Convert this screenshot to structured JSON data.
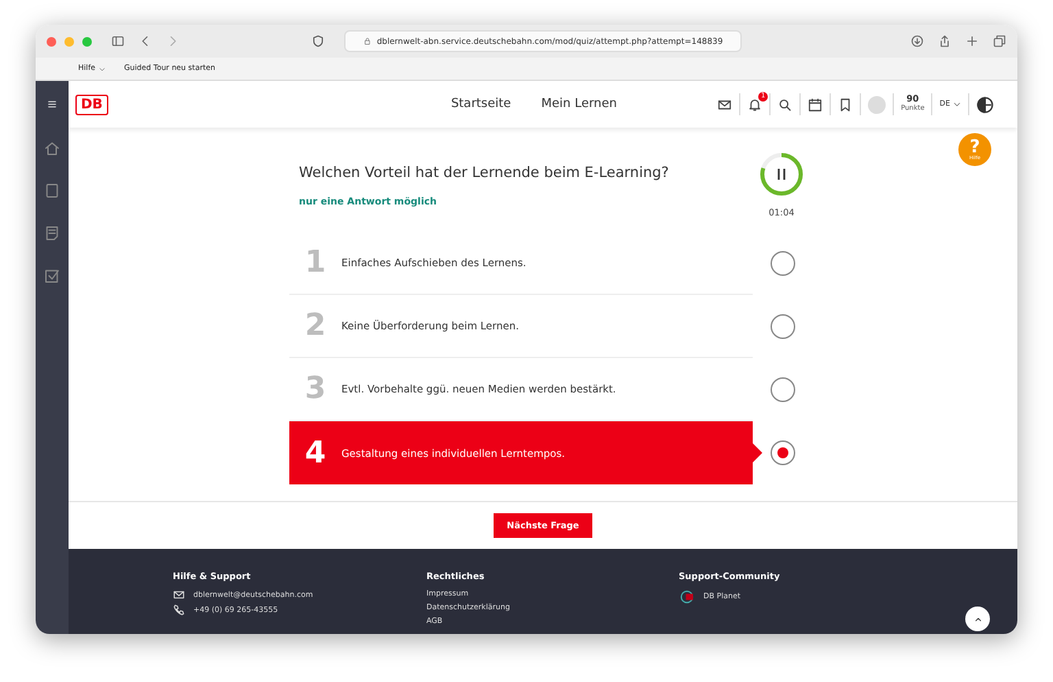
{
  "browser": {
    "url": "dblernwelt-abn.service.deutschebahn.com/mod/quiz/attempt.php?attempt=148839"
  },
  "bookmarks": [
    {
      "label": "Hilfe",
      "kind": "menu"
    },
    {
      "label": "Guided Tour neu starten",
      "kind": "link"
    }
  ],
  "header": {
    "logo": "DB",
    "nav": [
      {
        "label": "Startseite"
      },
      {
        "label": "Mein Lernen"
      }
    ],
    "notification_count": "1",
    "points": "90",
    "points_label": "Punkte",
    "language": "DE"
  },
  "help_button": {
    "icon": "?",
    "label": "Hilfe"
  },
  "question": {
    "text": "Welchen Vorteil hat der Lernende beim E-Learning?",
    "hint": "nur eine Antwort möglich",
    "timer": {
      "level": 0.8,
      "time": "01:04"
    }
  },
  "answers": [
    {
      "number": "1",
      "text": "Einfaches Aufschieben des Lernens.",
      "selected": false
    },
    {
      "number": "2",
      "text": "Keine Überforderung beim Lernen.",
      "selected": false
    },
    {
      "number": "3",
      "text": "Evtl. Vorbehalte ggü. neuen Medien werden bestärkt.",
      "selected": false
    },
    {
      "number": "4",
      "text": "Gestaltung eines individuellen Lerntempos.",
      "selected": true
    }
  ],
  "next_button": "Nächste Frage",
  "footer": {
    "columns": [
      {
        "title": "Hilfe & Support",
        "items": [
          {
            "kind": "mail",
            "text": "dblernwelt@deutschebahn.com"
          },
          {
            "kind": "phone",
            "text": "+49 (0) 69 265-43555"
          }
        ]
      },
      {
        "title": "Rechtliches",
        "items": [
          {
            "kind": "link",
            "text": "Impressum"
          },
          {
            "kind": "link",
            "text": "Datenschutzerklärung"
          },
          {
            "kind": "link",
            "text": "AGB"
          }
        ]
      },
      {
        "title": "Support-Community",
        "items": [
          {
            "kind": "community",
            "text": "DB Planet"
          }
        ]
      }
    ]
  }
}
